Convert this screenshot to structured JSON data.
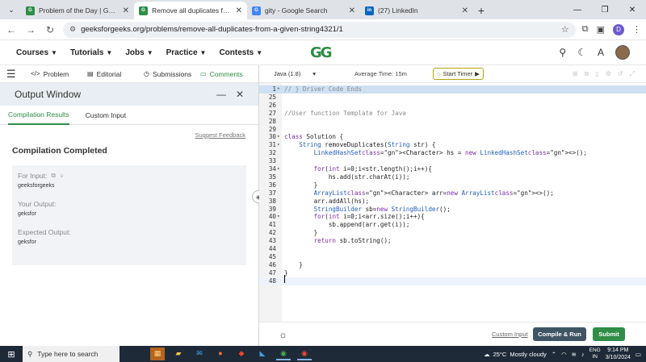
{
  "browser": {
    "tabs": [
      {
        "title": "Problem of the Day | GeeksforG",
        "favicon_text": "G",
        "favicon_color": "#2f8d46",
        "active": false
      },
      {
        "title": "Remove all duplicates from a gi",
        "favicon_text": "G",
        "favicon_color": "#2f8d46",
        "active": true
      },
      {
        "title": "gity - Google Search",
        "favicon_text": "G",
        "favicon_color": "#4285f4",
        "active": false
      },
      {
        "title": "(27) LinkedIn",
        "favicon_text": "in",
        "favicon_color": "#0a66c2",
        "active": false
      }
    ],
    "url": "geeksforgeeks.org/problems/remove-all-duplicates-from-a-given-string4321/1",
    "profile_initial": "D"
  },
  "site": {
    "logo": "GG",
    "nav": [
      "Courses",
      "Tutorials",
      "Jobs",
      "Practice",
      "Contests"
    ]
  },
  "problem_tabs": [
    "Problem",
    "Editorial",
    "Submissions",
    "Comments"
  ],
  "output_window": {
    "title": "Output Window",
    "tabs": [
      "Compilation Results",
      "Custom Input"
    ],
    "suggest_feedback": "Suggest Feedback",
    "status": "Compilation Completed",
    "for_input_label": "For Input:",
    "for_input_value": "geeksforgeeks",
    "your_output_label": "Your Output:",
    "your_output_value": "geksfor",
    "expected_output_label": "Expected Output:",
    "expected_output_value": "geksfor"
  },
  "editor": {
    "language": "Java (1.8)",
    "average_time": "Average Time: 15m",
    "start_timer": "Start Timer",
    "lines": [
      {
        "n": "1",
        "fold": "+",
        "text": "// } Driver Code Ends"
      },
      {
        "n": "25",
        "fold": "",
        "text": ""
      },
      {
        "n": "26",
        "fold": "",
        "text": ""
      },
      {
        "n": "27",
        "fold": "",
        "text": "//User function Template for Java"
      },
      {
        "n": "28",
        "fold": "",
        "text": ""
      },
      {
        "n": "29",
        "fold": "",
        "text": ""
      },
      {
        "n": "30",
        "fold": "▾",
        "text": "class Solution {"
      },
      {
        "n": "31",
        "fold": "▾",
        "text": "    String removeDuplicates(String str) {"
      },
      {
        "n": "32",
        "fold": "",
        "text": "        LinkedHashSet<Character> hs = new LinkedHashSet<>();"
      },
      {
        "n": "33",
        "fold": "",
        "text": ""
      },
      {
        "n": "34",
        "fold": "▾",
        "text": "        for(int i=0;i<str.length();i++){"
      },
      {
        "n": "35",
        "fold": "",
        "text": "            hs.add(str.charAt(i));"
      },
      {
        "n": "36",
        "fold": "",
        "text": "        }"
      },
      {
        "n": "37",
        "fold": "",
        "text": "        ArrayList<Character> arr=new ArrayList<>();"
      },
      {
        "n": "38",
        "fold": "",
        "text": "        arr.addAll(hs);"
      },
      {
        "n": "39",
        "fold": "",
        "text": "        StringBuilder sb=new StringBuilder();"
      },
      {
        "n": "40",
        "fold": "▾",
        "text": "        for(int i=0;i<arr.size();i++){"
      },
      {
        "n": "41",
        "fold": "",
        "text": "            sb.append(arr.get(i));"
      },
      {
        "n": "42",
        "fold": "",
        "text": "        }"
      },
      {
        "n": "43",
        "fold": "",
        "text": "        return sb.toString();"
      },
      {
        "n": "44",
        "fold": "",
        "text": ""
      },
      {
        "n": "45",
        "fold": "",
        "text": ""
      },
      {
        "n": "46",
        "fold": "",
        "text": "    }"
      },
      {
        "n": "47",
        "fold": "",
        "text": "}"
      },
      {
        "n": "48",
        "fold": "",
        "text": ""
      }
    ],
    "custom_input": "Custom Input",
    "compile_run": "Compile & Run",
    "submit": "Submit"
  },
  "taskbar": {
    "search_placeholder": "Type here to search",
    "temperature": "25°C",
    "weather": "Mostly cloudy",
    "lang_top": "ENG",
    "lang_bottom": "IN",
    "time": "9:14 PM",
    "date": "3/10/2024"
  },
  "colors": {
    "brand": "#2f8d46",
    "compile_button": "#3f5564",
    "taskbar": "#1e2a38"
  }
}
